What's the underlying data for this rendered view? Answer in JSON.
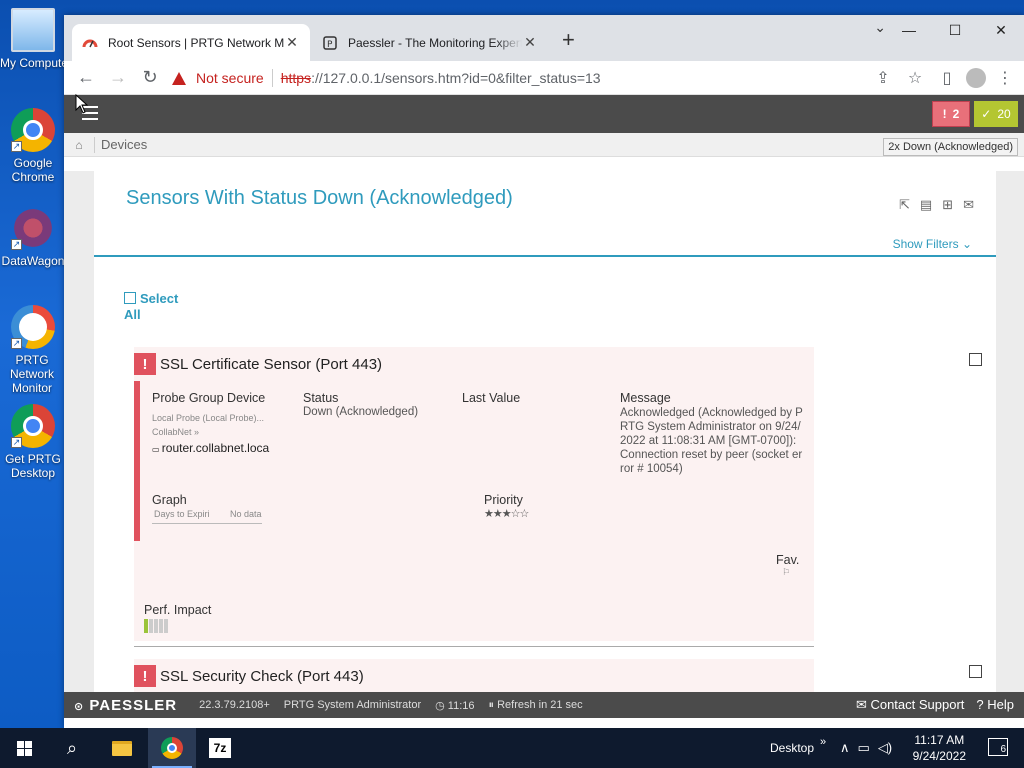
{
  "desktop": {
    "icons": [
      {
        "label": "My Computer",
        "icon": "computer-icon"
      },
      {
        "label": "Google Chrome",
        "icon": "chrome-icon"
      },
      {
        "label": "DataWagon",
        "icon": "datawagon-icon"
      },
      {
        "label": "PRTG Network Monitor",
        "icon": "prtg-icon"
      },
      {
        "label": "Get PRTG Desktop",
        "icon": "chrome-icon"
      }
    ]
  },
  "browser": {
    "tabs": [
      {
        "title": "Root Sensors | PRTG Network Mo",
        "active": true
      },
      {
        "title": "Paessler - The Monitoring Expert",
        "active": false
      }
    ],
    "security_label": "Not secure",
    "url_scheme": "https",
    "url_rest": "://127.0.0.1/sensors.htm?id=0&filter_status=13"
  },
  "prtg": {
    "status_down_count": "2",
    "status_up_count": "20",
    "breadcrumb": "Devices",
    "tooltip": "2x Down (Acknowledged)",
    "page_title": "Sensors With Status Down (Acknowledged)",
    "show_filters": "Show Filters",
    "select_all": "Select All",
    "columns": {
      "probe_group_device": "Probe Group Device",
      "status": "Status",
      "last_value": "Last Value",
      "message": "Message",
      "graph": "Graph",
      "priority": "Priority",
      "fav": "Fav.",
      "perf_impact": "Perf. Impact"
    },
    "sensors": [
      {
        "name": "SSL Certificate Sensor (Port 443)",
        "probe": "Local Probe (Local Probe)...",
        "group": "CollabNet »",
        "device": "router.collabnet.loca",
        "status": "Down (Acknowledged)",
        "message": "Acknowledged (Acknowledged by PRTG System Administrator on 9/24/2022 at 11:08:31 AM [GMT-0700]): Connection reset by peer (socket error # 10054)",
        "graph_channel": "Days to Expiri",
        "graph_value": "No data",
        "priority_stars": 3
      },
      {
        "name": "SSL Security Check (Port 443)"
      }
    ],
    "footer": {
      "logo": "PAESSLER",
      "version": "22.3.79.2108+",
      "user": "PRTG System Administrator",
      "time": "11:16",
      "refresh": "Refresh in 21 sec",
      "contact": "Contact Support",
      "help": "Help"
    }
  },
  "taskbar": {
    "desktop_label": "Desktop",
    "time": "11:17 AM",
    "date": "9/24/2022",
    "notifications": "6"
  }
}
